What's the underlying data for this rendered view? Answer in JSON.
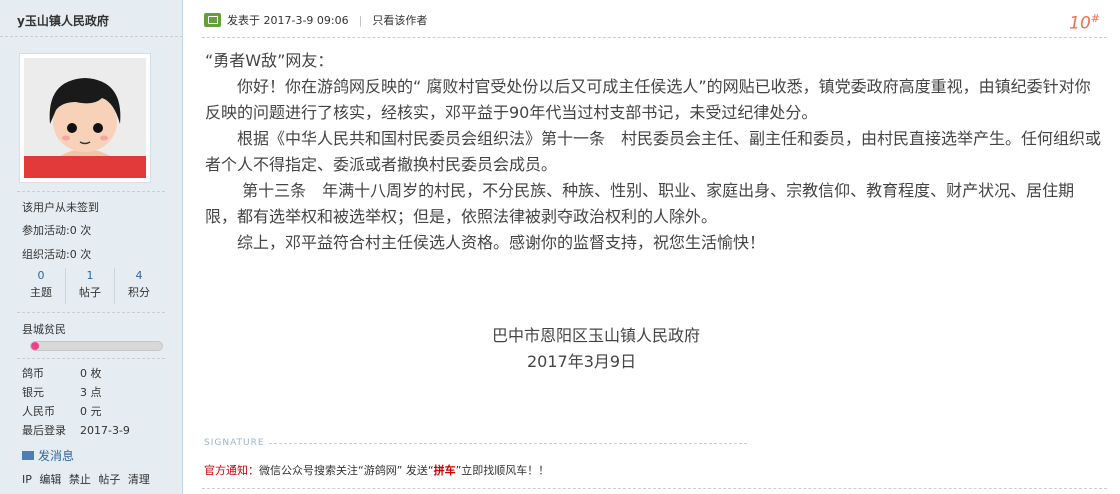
{
  "user": {
    "name": "y玉山镇人民政府",
    "signin": "该用户从未签到",
    "join_label": "参加活动:",
    "join_value": "0 次",
    "org_label": "组织活动:",
    "org_value": "0 次",
    "stats": [
      {
        "num": "0",
        "label": "主题"
      },
      {
        "num": "1",
        "label": "帖子"
      },
      {
        "num": "4",
        "label": "积分"
      }
    ],
    "group": "县城贫民",
    "progress": 0.06,
    "details": [
      {
        "key": "鸽币",
        "val": "0 枚"
      },
      {
        "key": "银元",
        "val": "3 点"
      },
      {
        "key": "人民币",
        "val": "0 元"
      },
      {
        "key": "最后登录",
        "val": "2017-3-9"
      }
    ],
    "message": "发消息",
    "tools": [
      "IP",
      "编辑",
      "禁止",
      "帖子",
      "清理"
    ]
  },
  "post": {
    "posted": "发表于 2017-3-9 09:06",
    "only_author": "只看该作者",
    "floor": "10",
    "floor_mark": "#",
    "paragraphs": [
      "“勇者W敌”网友：",
      "　　你好！你在游鸽网反映的“ 腐败村官受处份以后又可成主任侯选人”的网贴已收悉，镇党委政府高度重视，由镇纪委针对你反映的问题进行了核实，经核实，邓平益于90年代当过村支部书记，未受过纪律处分。",
      "　　根据《中华人民共和国村民委员会组织法》第十一条　村民委员会主任、副主任和委员，由村民直接选举产生。任何组织或者个人不得指定、委派或者撤换村民委员会成员。",
      "　　 第十三条　年满十八周岁的村民，不分民族、种族、性别、职业、家庭出身、宗教信仰、教育程度、财产状况、居住期限，都有选举权和被选举权；但是，依照法律被剥夺政治权利的人除外。",
      "　　综上，邓平益符合村主任侯选人资格。感谢你的监督支持，祝您生活愉快！"
    ],
    "sign_org": "巴中市恩阳区玉山镇人民政府",
    "sign_date": "2017年3月9日"
  },
  "signature": {
    "label": "SIGNATURE",
    "notice_prefix": "官方通知：",
    "notice_text": "微信公众号搜索关注“游鸽网” 发送“",
    "notice_keyword": "拼车",
    "notice_suffix": "”立即找顺风车！！"
  }
}
